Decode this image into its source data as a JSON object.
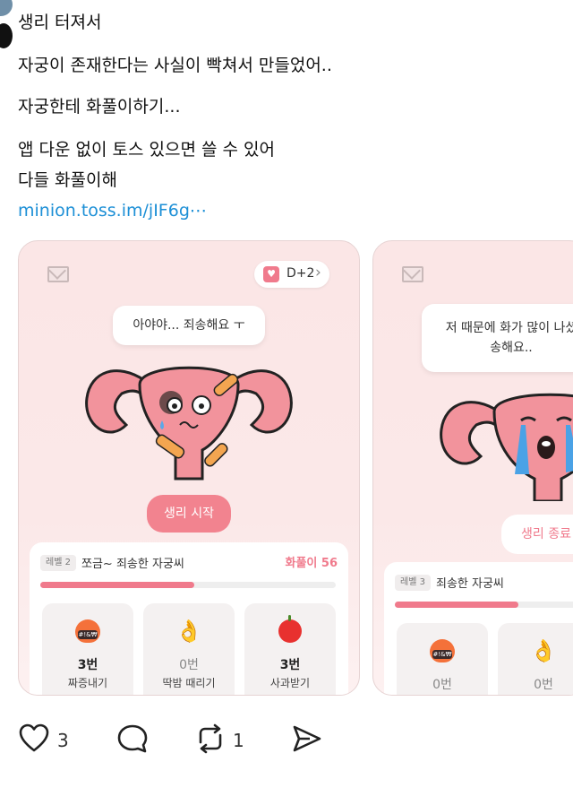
{
  "post": {
    "author": "생리 터져서",
    "lines": [
      "자궁이 존재한다는 사실이 빡쳐서 만들었어..",
      "자궁한테 화풀이하기...",
      "앱 다운 없이 토스 있으면 쓸 수 있어",
      "다들 화풀이해"
    ],
    "link": "minion.toss.im/jIF6g⋯"
  },
  "card1": {
    "dday": "D+2",
    "bubble": "아야야... 죄송해요 ㅜ",
    "button": "생리 시작",
    "level_badge": "레벨 2",
    "level_name": "쪼금~ 죄송한 자궁씨",
    "score": "화풀이 56",
    "progress": 0.52,
    "stats": [
      {
        "icon": "angry-face-icon",
        "count": "3번",
        "label": "짜증내기"
      },
      {
        "icon": "ok-hand-icon",
        "count": "0번",
        "label": "딱밤 때리기"
      },
      {
        "icon": "apple-icon",
        "count": "3번",
        "label": "사과받기"
      }
    ]
  },
  "card2": {
    "bubble_line1": "저 때문에 화가 많이 나셨",
    "bubble_line2": "송해요..",
    "button": "생리 종료",
    "level_badge": "레벨 3",
    "level_name": "죄송한 자궁씨",
    "progress": 0.6,
    "stats": [
      {
        "icon": "angry-face-icon",
        "count": "0번"
      },
      {
        "icon": "ok-hand-icon",
        "count": "0번"
      }
    ]
  },
  "actions": {
    "likes": "3",
    "reposts": "1"
  },
  "colors": {
    "link": "#1c8fd6",
    "accent_pink": "#f07a8c",
    "card_bg": "#fbe6e6"
  }
}
